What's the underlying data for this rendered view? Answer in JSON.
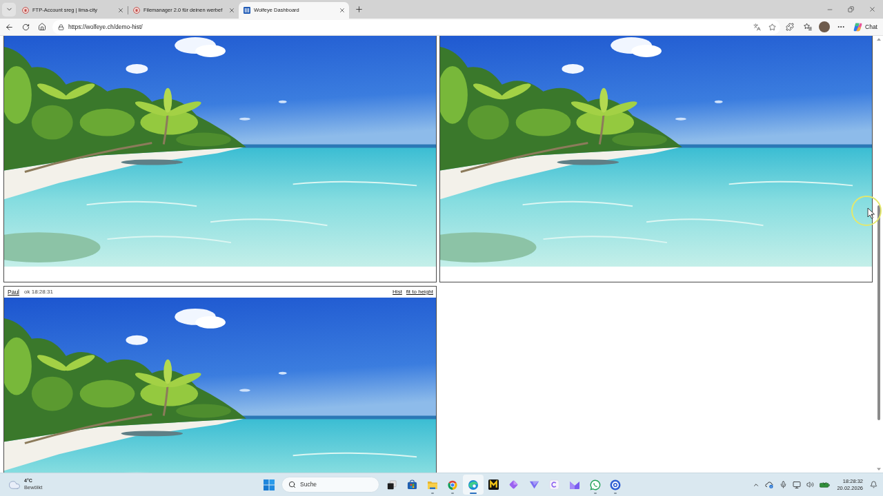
{
  "browser": {
    "tabs": [
      {
        "title": "FTP-Account sreg | lima-city",
        "selected": false
      },
      {
        "title": "Filemanager 2.0 für deinen werbef",
        "selected": false
      },
      {
        "title": "Wolfeye Dashboard",
        "selected": true
      }
    ],
    "address_bar": {
      "value": "https://wolfeye.ch/demo-hist/"
    },
    "chat_button": {
      "label": "Chat"
    }
  },
  "feeds": [
    {
      "header_visible": false
    },
    {
      "header_visible": false
    },
    {
      "header_visible": true,
      "user": "Paul",
      "status": "ok 18:28:31",
      "links": [
        "Hist",
        "fit to height"
      ]
    }
  ],
  "taskbar": {
    "weather": {
      "temperature": "4°C",
      "condition": "Bewölkt"
    },
    "search": {
      "label": "Suche"
    },
    "apps": [
      {
        "running": false,
        "active": false
      },
      {
        "running": false,
        "active": false
      },
      {
        "running": true,
        "active": false
      },
      {
        "running": true,
        "active": false
      },
      {
        "running": true,
        "active": true
      },
      {
        "running": false,
        "active": false
      },
      {
        "running": false,
        "active": false
      },
      {
        "running": false,
        "active": false
      },
      {
        "running": false,
        "active": false
      },
      {
        "running": false,
        "active": false
      },
      {
        "running": true,
        "active": false
      },
      {
        "running": true,
        "active": false
      }
    ],
    "clock": {
      "time": "18:28:32",
      "date": "20.02.2026"
    }
  }
}
